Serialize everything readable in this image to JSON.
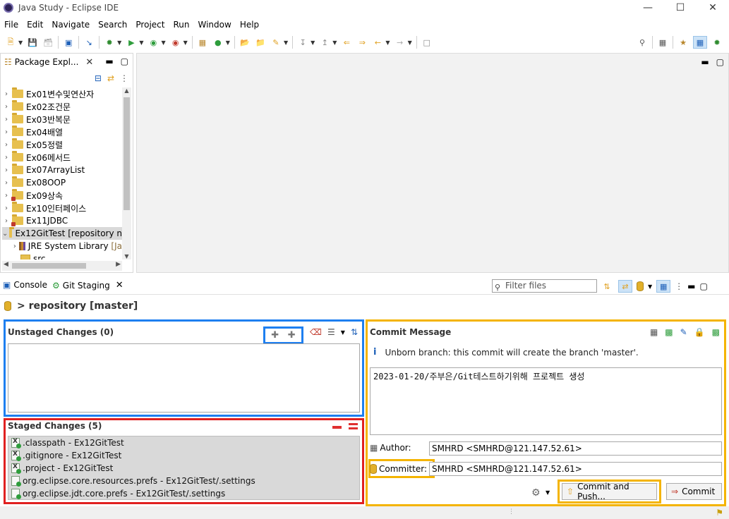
{
  "window": {
    "title": "Java Study - Eclipse IDE"
  },
  "menu": [
    "File",
    "Edit",
    "Navigate",
    "Search",
    "Project",
    "Run",
    "Window",
    "Help"
  ],
  "package_explorer": {
    "tab_label": "Package Expl...",
    "items": [
      {
        "label": "Ex01변수및연산자",
        "error": false
      },
      {
        "label": "Ex02조건문",
        "error": false
      },
      {
        "label": "Ex03반복문",
        "error": false
      },
      {
        "label": "Ex04배열",
        "error": false
      },
      {
        "label": "Ex05정렬",
        "error": false
      },
      {
        "label": "Ex06메서드",
        "error": false
      },
      {
        "label": "Ex07ArrayList",
        "error": false
      },
      {
        "label": "Ex08OOP",
        "error": false
      },
      {
        "label": "Ex09상속",
        "error": true
      },
      {
        "label": "Ex10인터페이스",
        "error": false
      },
      {
        "label": "Ex11JDBC",
        "error": true
      },
      {
        "label": "Ex12GitTest [repository n",
        "error": false,
        "selected": true,
        "expanded": true
      }
    ],
    "children": [
      {
        "label": "JRE System Library",
        "suffix": "[Ja"
      },
      {
        "label": "src"
      }
    ]
  },
  "bottom_panel": {
    "tabs": [
      {
        "label": "Console"
      },
      {
        "label": "Git Staging",
        "active": true
      }
    ],
    "filter_placeholder": "Filter files"
  },
  "git_staging": {
    "repo_header": "> repository [master]",
    "unstaged": {
      "title": "Unstaged Changes (0)",
      "files": []
    },
    "staged": {
      "title": "Staged Changes (5)",
      "files": [
        {
          "label": ".classpath - Ex12GitTest",
          "icon": "x"
        },
        {
          "label": ".gitignore - Ex12GitTest",
          "icon": "x"
        },
        {
          "label": ".project - Ex12GitTest",
          "icon": "x"
        },
        {
          "label": "org.eclipse.core.resources.prefs - Ex12GitTest/.settings",
          "icon": "file"
        },
        {
          "label": "org.eclipse.jdt.core.prefs - Ex12GitTest/.settings",
          "icon": "file"
        }
      ]
    },
    "commit": {
      "title": "Commit Message",
      "info": "Unborn branch: this commit will create the branch 'master'.",
      "message": "2023-01-20/주부은/Git테스트하기위해 프로젝트 생성",
      "author_label": "Author:",
      "author_value": "SMHRD <SMHRD@121.147.52.61>",
      "committer_label": "Committer:",
      "committer_value": "SMHRD <SMHRD@121.147.52.61>",
      "commit_push_label": "Commit and Push...",
      "commit_label": "Commit"
    }
  },
  "colors": {
    "unstaged_highlight": "#1e7ff0",
    "staged_highlight": "#e02020",
    "commit_highlight": "#f4b400"
  }
}
